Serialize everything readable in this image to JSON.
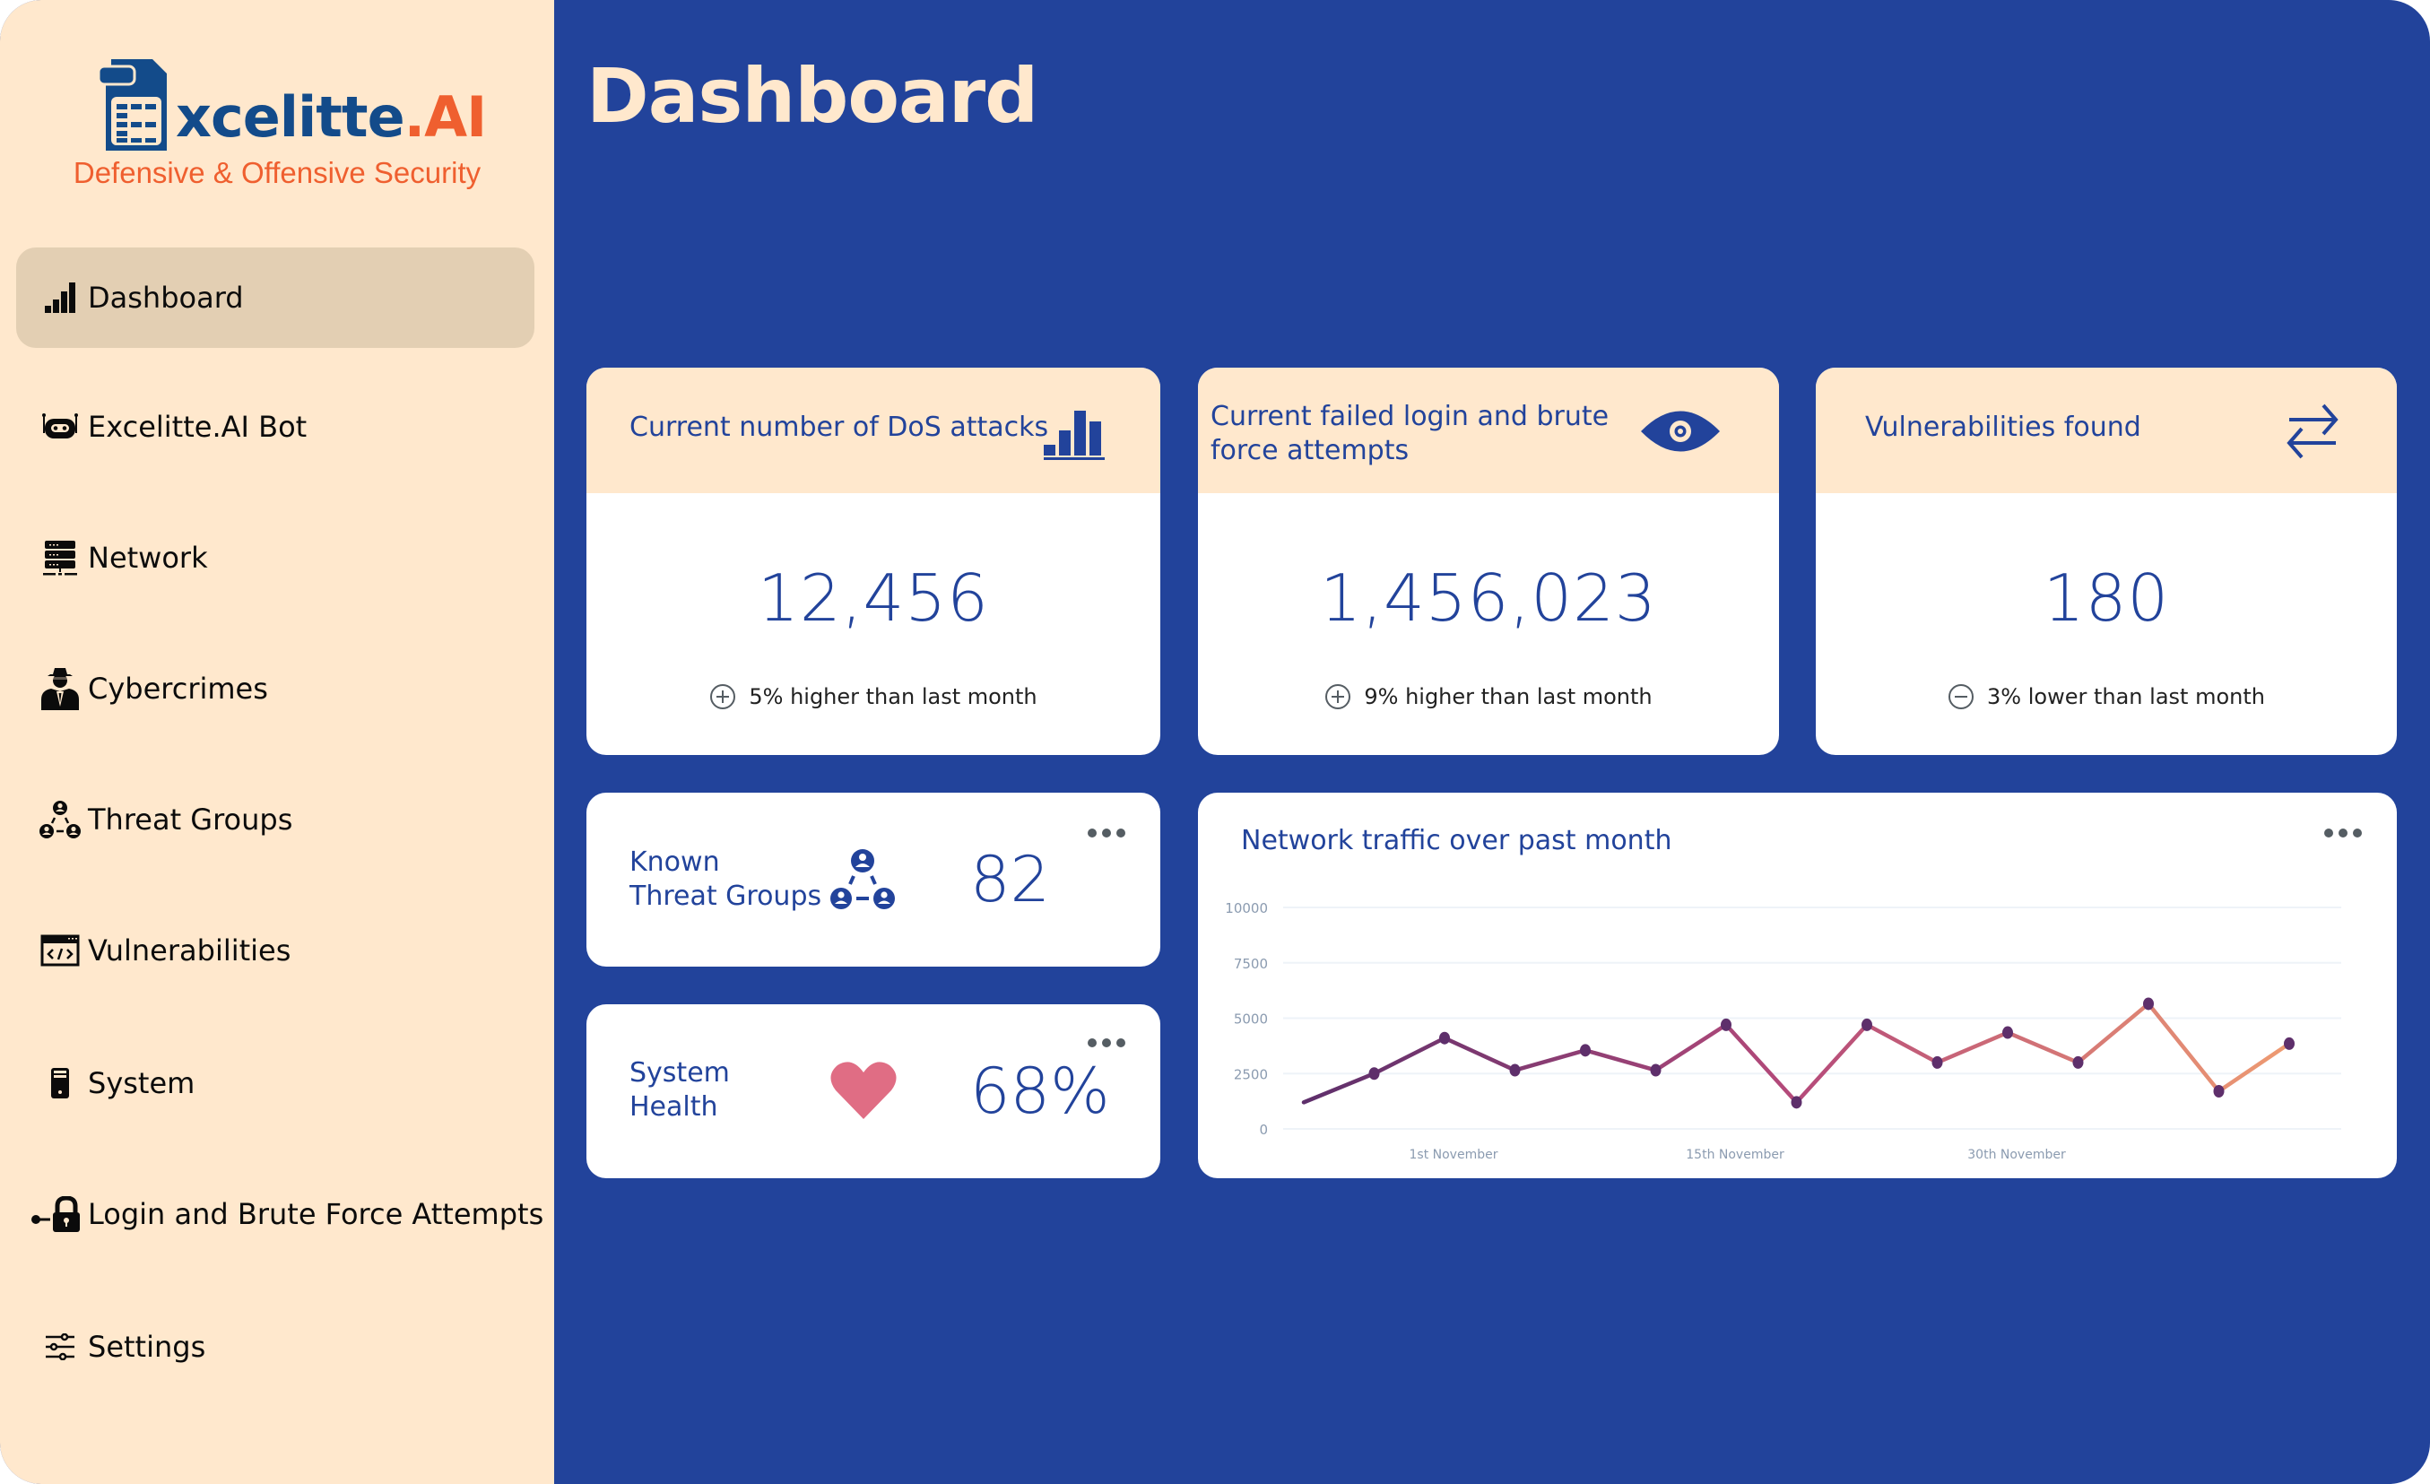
{
  "brand": {
    "name_main": "xcelitte",
    "name_suffix": ".AI",
    "tagline": "Defensive & Offensive Security",
    "colors": {
      "primary": "#134b8a",
      "accent": "#ef5f2f"
    }
  },
  "sidebar": {
    "items": [
      {
        "label": "Dashboard",
        "icon": "bar-chart-icon",
        "active": true
      },
      {
        "label": "Excelitte.AI Bot",
        "icon": "robot-icon",
        "active": false
      },
      {
        "label": "Network",
        "icon": "server-network-icon",
        "active": false
      },
      {
        "label": "Cybercrimes",
        "icon": "hacker-icon",
        "active": false
      },
      {
        "label": "Threat Groups",
        "icon": "group-network-icon",
        "active": false
      },
      {
        "label": "Vulnerabilities",
        "icon": "code-window-icon",
        "active": false
      },
      {
        "label": "System",
        "icon": "computer-tower-icon",
        "active": false
      },
      {
        "label": "Login and Brute Force Attempts",
        "icon": "key-lock-icon",
        "active": false
      },
      {
        "label": "Settings",
        "icon": "sliders-icon",
        "active": false
      }
    ]
  },
  "header": {
    "title": "Dashboard"
  },
  "stats": [
    {
      "title": "Current number of DoS attacks",
      "icon": "bar-chart-icon",
      "value": "12,456",
      "delta_sign": "plus",
      "delta_text": "5% higher than last month"
    },
    {
      "title_line1": "Current failed login and brute",
      "title_line2": "force attempts",
      "icon": "eye-icon",
      "value": "1,456,023",
      "delta_sign": "plus",
      "delta_text": "9% higher than last month"
    },
    {
      "title": "Vulnerabilities found",
      "icon": "swap-arrows-icon",
      "value": "180",
      "delta_sign": "minus",
      "delta_text": "3% lower than last month"
    }
  ],
  "threat_groups": {
    "line1": "Known",
    "line2": "Threat Groups",
    "icon": "group-network-icon",
    "value": "82"
  },
  "system_health": {
    "line1": "System",
    "line2": "Health",
    "icon": "heart-icon",
    "value": "68%",
    "percent": 68,
    "heart_color": "#e06d84"
  },
  "chart_data": {
    "type": "line",
    "title": "Network traffic over past month",
    "xlabel": "",
    "ylabel": "",
    "ylim": [
      0,
      10000
    ],
    "yticks": [
      0,
      2500,
      5000,
      7500,
      10000
    ],
    "xtick_labels": [
      {
        "label": "1st November",
        "index": 2
      },
      {
        "label": "15th November",
        "index": 6
      },
      {
        "label": "30th November",
        "index": 10
      }
    ],
    "grid": true,
    "series": [
      {
        "name": "Network traffic",
        "values": [
          1200,
          2500,
          4100,
          2650,
          3550,
          2650,
          4700,
          1200,
          4700,
          3000,
          4350,
          3000,
          5650,
          1700,
          3850
        ]
      }
    ],
    "gradient": [
      "#5e2f6b",
      "#b54a7a",
      "#ee9b72"
    ],
    "marker_color": "#5e2f6b"
  }
}
